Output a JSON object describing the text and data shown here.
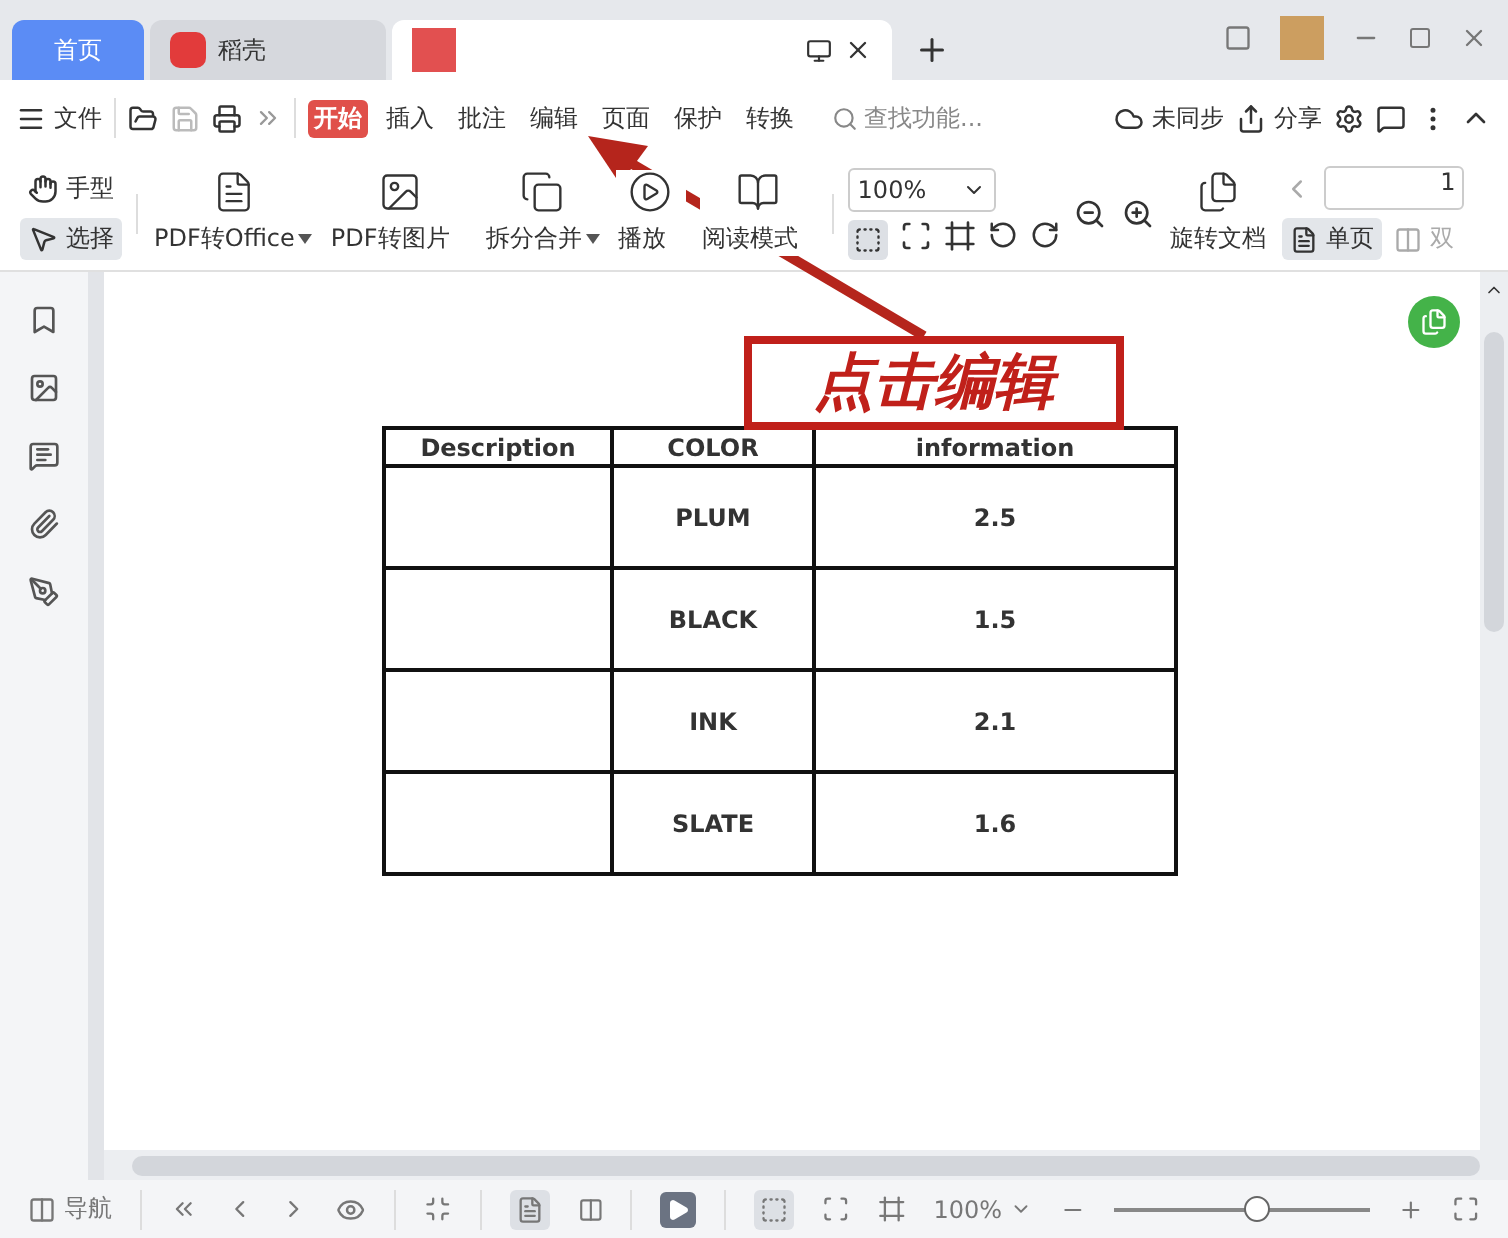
{
  "tabs": [
    {
      "label": "首页",
      "kind": "home",
      "selected": false
    },
    {
      "label": "稻壳",
      "kind": "docer",
      "selected": false
    },
    {
      "kind": "doc",
      "selected": true
    }
  ],
  "menu": {
    "file": "文件",
    "tabs": [
      {
        "label": "开始",
        "selected": true
      },
      {
        "label": "插入",
        "selected": false
      },
      {
        "label": "批注",
        "selected": false
      },
      {
        "label": "编辑",
        "selected": false
      },
      {
        "label": "页面",
        "selected": false
      },
      {
        "label": "保护",
        "selected": false
      },
      {
        "label": "转换",
        "selected": false
      }
    ],
    "search": {
      "placeholder": "查找功能..."
    },
    "sync": "未同步",
    "share": "分享"
  },
  "ribbon": {
    "hand": "手型",
    "select": {
      "label": "选择",
      "selected": true
    },
    "tools": [
      {
        "label": "PDF转Office",
        "kind": "office",
        "dropdown": true
      },
      {
        "label": "PDF转图片",
        "kind": "image",
        "dropdown": false
      },
      {
        "label": "拆分合并",
        "kind": "split",
        "dropdown": true
      },
      {
        "label": "播放",
        "kind": "play",
        "dropdown": false
      },
      {
        "label": "阅读模式",
        "kind": "read",
        "dropdown": false
      }
    ],
    "zoom": "100%",
    "rotate": "旋转文档",
    "page_field": "1",
    "single": {
      "label": "单页",
      "selected": true
    },
    "double": {
      "label": "双",
      "selected": false
    }
  },
  "table": {
    "columns": [
      "Description",
      "COLOR",
      "information"
    ],
    "rows": [
      [
        "",
        "PLUM",
        "2.5"
      ],
      [
        "",
        "BLACK",
        "1.5"
      ],
      [
        "",
        "INK",
        "2.1"
      ],
      [
        "",
        "SLATE",
        "1.6"
      ]
    ]
  },
  "annotation": {
    "text": "点击编辑"
  },
  "status_bar": {
    "nav": "导航",
    "zoom": "100%",
    "level": 0.55
  }
}
